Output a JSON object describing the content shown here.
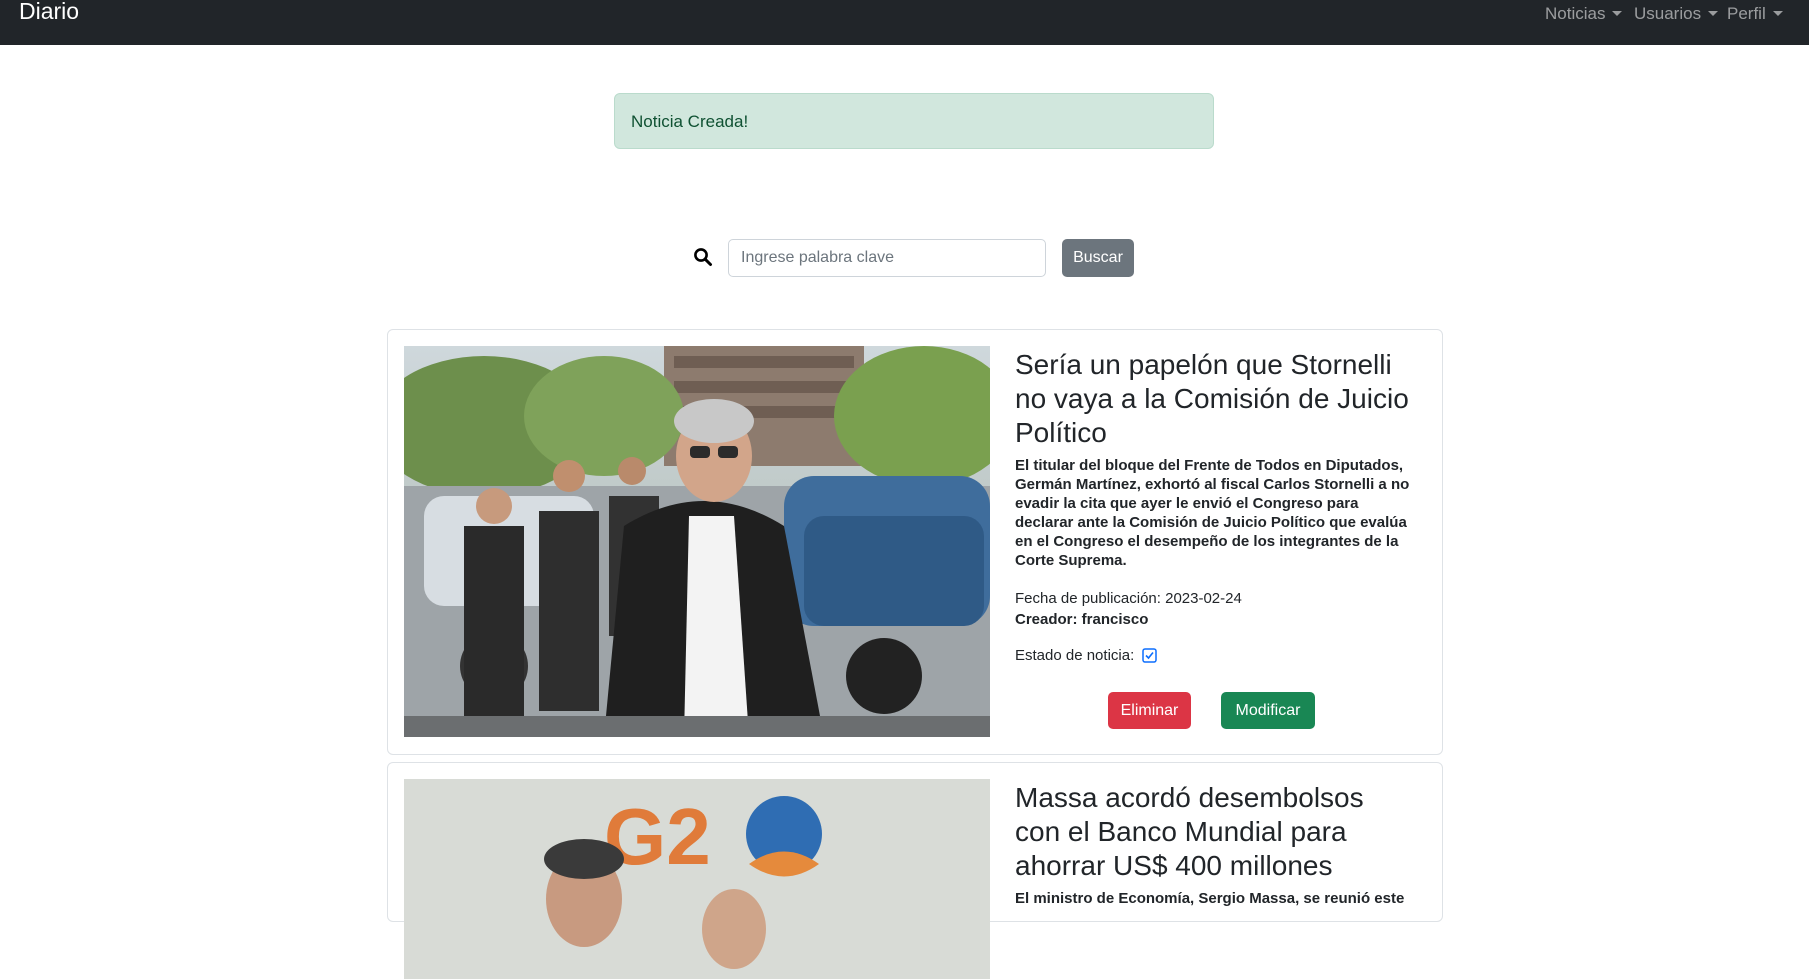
{
  "navbar": {
    "brand": "Diario",
    "menus": [
      {
        "label": "Noticias"
      },
      {
        "label": "Usuarios"
      },
      {
        "label": "Perfil"
      }
    ]
  },
  "alert": {
    "message": "Noticia Creada!",
    "color": "#d1e7dd"
  },
  "search": {
    "icon": "search-icon",
    "placeholder": "Ingrese palabra clave",
    "value": "",
    "button_label": "Buscar"
  },
  "news": [
    {
      "title": "Sería un papelón que Stornelli no vaya a la Comisión de Juicio Político",
      "summary": "El titular del bloque del Frente de Todos en Diputados, Germán Martínez, exhortó al fiscal Carlos Stornelli a no evadir la cita que ayer le envió el Congreso para declarar ante la Comisión de Juicio Político que evalúa en el Congreso el desempeño de los integrantes de la Corte Suprema.",
      "date_line": "Fecha de publicación: 2023-02-24",
      "creator_line": "Creador: francisco",
      "status_label": "Estado de noticia:",
      "status_checked": true,
      "delete_label": "Eliminar",
      "modify_label": "Modificar"
    },
    {
      "title": "Massa acordó desembolsos con el Banco Mundial para ahorrar US$ 400 millones",
      "summary": "El ministro de Economía, Sergio Massa, se reunió este"
    }
  ],
  "colors": {
    "navbar": "#212529",
    "danger": "#dc3545",
    "success": "#198754",
    "secondary": "#6c757d"
  }
}
